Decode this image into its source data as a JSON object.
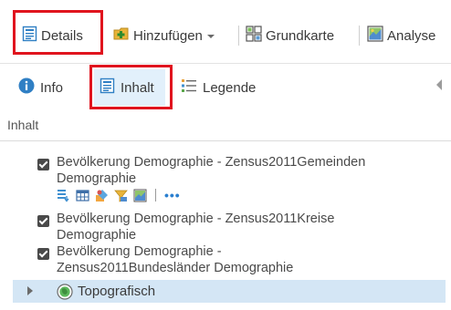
{
  "toolbar": {
    "details_label": "Details",
    "add_label": "Hinzufügen",
    "basemap_label": "Grundkarte",
    "analysis_label": "Analyse"
  },
  "tabs": {
    "info_label": "Info",
    "content_label": "Inhalt",
    "legend_label": "Legende"
  },
  "content": {
    "section_title": "Inhalt",
    "layers": [
      {
        "line1": "Bevölkerung Demographie - Zensus2011Gemeinden",
        "line2": "Demographie",
        "checked": true
      },
      {
        "line1": "Bevölkerung Demographie - Zensus2011Kreise",
        "line2": "Demographie",
        "checked": true
      },
      {
        "line1": "Bevölkerung Demographie -",
        "line2": "Zensus2011Bundesländer Demographie",
        "checked": true
      }
    ],
    "layer_tools": [
      "show-table-icon",
      "table-icon",
      "change-style-icon",
      "filter-icon",
      "analysis-icon",
      "more-options-icon"
    ],
    "more_glyph": "•••",
    "basemap_layer_label": "Topografisch"
  },
  "colors": {
    "highlight_box": "#e0141e",
    "active_tab_bg": "#e2f0fb",
    "selected_row_bg": "#d4e6f5",
    "link_blue": "#2a7fcf"
  }
}
